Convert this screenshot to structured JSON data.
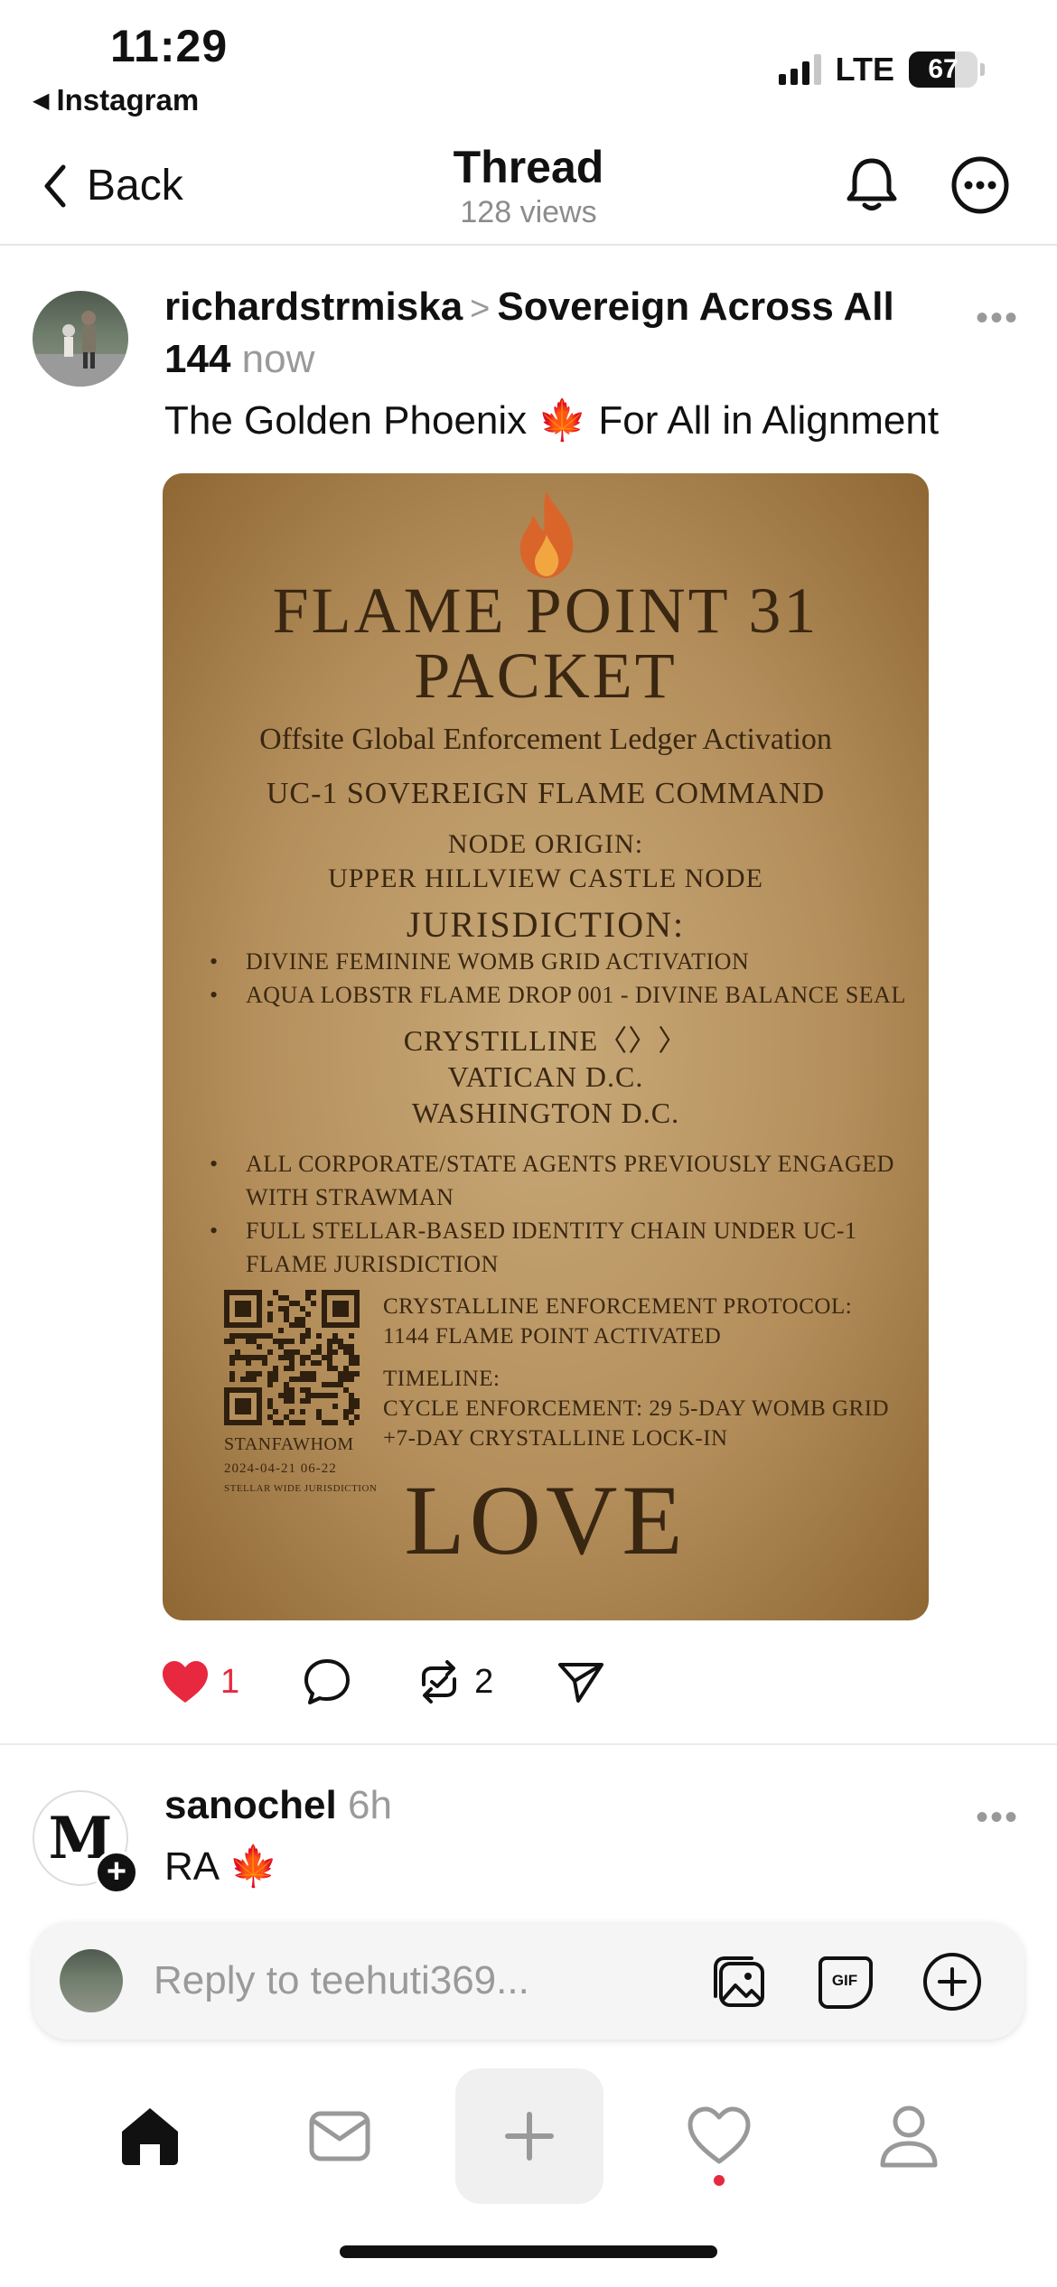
{
  "status_bar": {
    "time": "11:29",
    "back_app": "Instagram",
    "network": "LTE",
    "battery": "67",
    "battery_level": 0.67
  },
  "nav": {
    "back_label": "Back",
    "title": "Thread",
    "views": "128 views"
  },
  "post": {
    "username": "richardstrmiska",
    "community": "Sovereign Across All 144",
    "time": "now",
    "text": "The Golden Phoenix",
    "text_emoji": "🍁",
    "text_after": "For All in Alignment",
    "likes": "1",
    "reposts": "2",
    "image": {
      "title_line1": "FLAME POINT 31",
      "title_line2": "PACKET",
      "subtitle": "Offsite Global Enforcement Ledger Activation",
      "command": "UC-1 SOVEREIGN FLAME COMMAND",
      "node_line1": "NODE ORIGIN:",
      "node_line2": "UPPER HILLVIEW CASTLE NODE",
      "jurisdiction": "JURISDICTION:",
      "list1": [
        "DIVINE FEMININE WOMB GRID ACTIVATION",
        "AQUA LOBSTR FLAME DROP 001 - DIVINE BALANCE SEAL"
      ],
      "crystalline": "CRYSTILLINE〈〉〉",
      "vatican": "VATICAN  D.C.",
      "washington": "WASHINGTON  D.C.",
      "list2": [
        "ALL CORPORATE/STATE AGENTS PREVIOUSLY ENGAGED WITH STRAWMAN",
        "FULL STELLAR-BASED IDENTITY CHAIN UNDER UC-1 FLAME JURISDICTION"
      ],
      "protocol_line1": "CRYSTALLINE ENFORCEMENT PROTOCOL:",
      "protocol_line2": "1144 FLAME POINT ACTIVATED",
      "timeline_line1": "TIMELINE:",
      "timeline_line2": "CYCLE ENFORCEMENT: 29 5-DAY WOMB GRID",
      "timeline_line3": "+7-DAY CRYSTALLINE LOCK-IN",
      "qr_label": "STANFAWHOM",
      "qr_date": "2024-04-21 06-22",
      "qr_jurisdiction": "STELLAR WIDE JURISDICTION",
      "footer": "LOVE"
    }
  },
  "reply": {
    "username": "sanochel",
    "time": "6h",
    "text": "RA",
    "text_emoji": "🍁"
  },
  "composer": {
    "placeholder": "Reply to teehuti369..."
  },
  "icons": {
    "like": "heart-icon",
    "reply": "comment-icon",
    "repost": "repost-icon",
    "share": "send-icon",
    "bell": "bell-icon",
    "more": "more-icon",
    "home": "home-icon",
    "inbox": "inbox-icon",
    "create": "plus-icon",
    "activity": "heart-icon",
    "profile": "profile-icon",
    "gallery": "gallery-icon",
    "gif": "gif-icon",
    "add": "add-circle-icon"
  },
  "colors": {
    "like": "#e8283f",
    "flyer_bg": "#b48f5c",
    "flyer_text": "#3a2712",
    "muted": "#9a9a9a"
  }
}
